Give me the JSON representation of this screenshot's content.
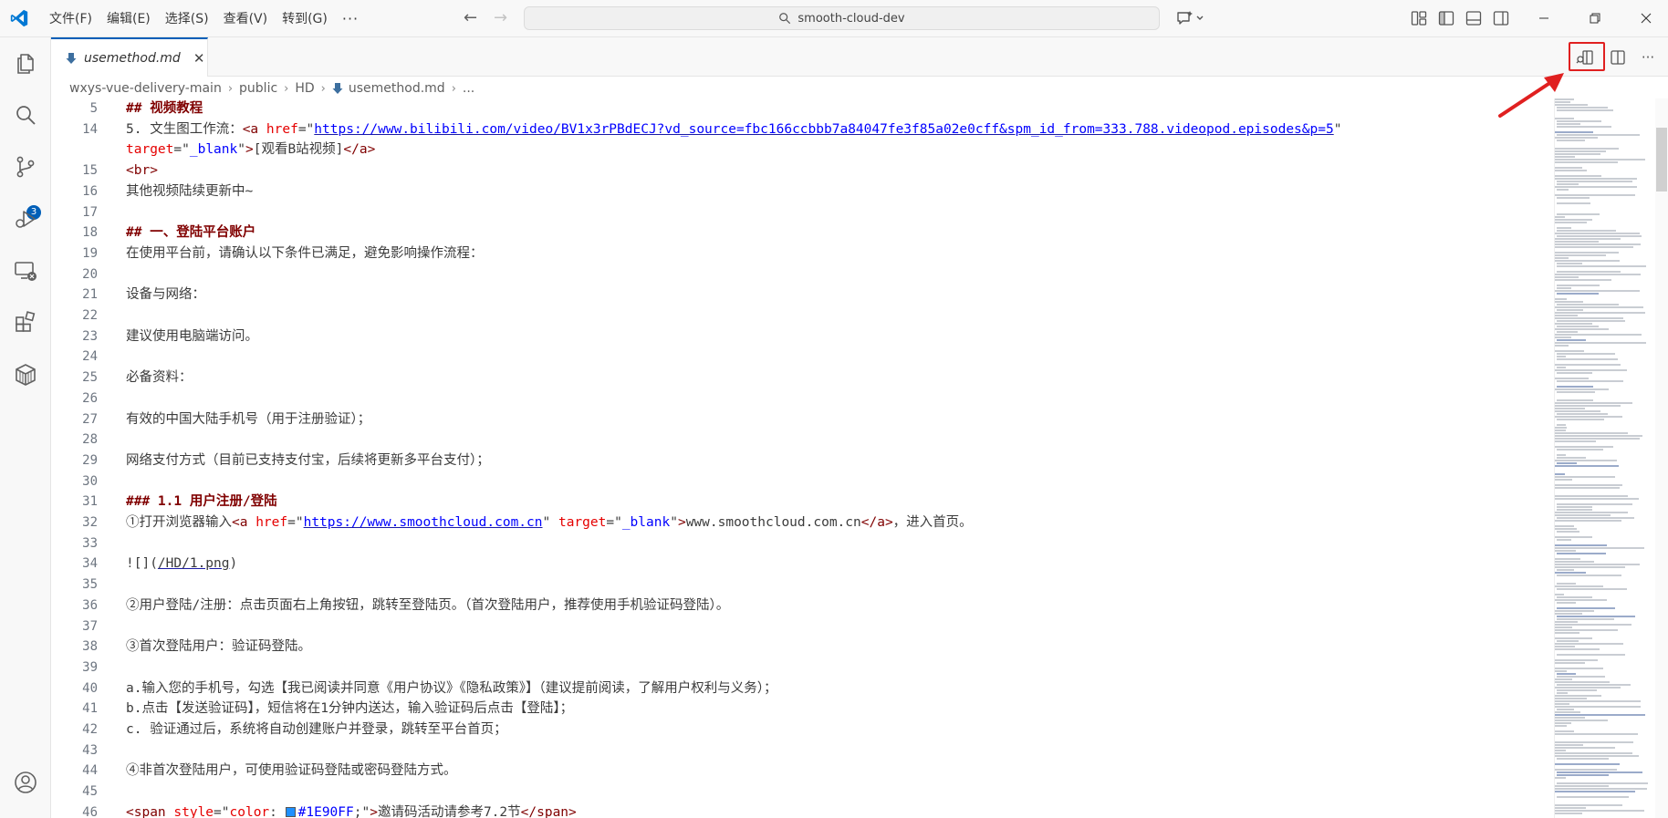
{
  "menu": {
    "items": [
      "文件(F)",
      "编辑(E)",
      "选择(S)",
      "查看(V)",
      "转到(G)"
    ],
    "more": "···"
  },
  "search": {
    "text": "smooth-cloud-dev"
  },
  "activity": {
    "scm_badge": "3"
  },
  "tab": {
    "label": "usemethod.md",
    "close": "✕"
  },
  "editor_actions": {
    "more": "···"
  },
  "breadcrumb": [
    "wxys-vue-delivery-main",
    "public",
    "HD",
    "usemethod.md",
    "..."
  ],
  "lines": [
    {
      "n": "5",
      "parts": [
        [
          "hd",
          "## 视频教程"
        ]
      ]
    },
    {
      "n": "14",
      "parts": [
        [
          "",
          "5. 文生图工作流："
        ],
        [
          "tg",
          "<a "
        ],
        [
          "at",
          "href"
        ],
        [
          "",
          "=\""
        ],
        [
          "sv ul",
          "https://www.bilibili.com/video/BV1x3rPBdECJ?vd_source=fbc166ccbbb7a84047fe3f85a02e0cff&spm_id_from=333.788.videopod.episodes&p=5"
        ],
        [
          "",
          "\""
        ]
      ]
    },
    {
      "n": "",
      "parts": [
        [
          "at",
          "target"
        ],
        [
          "",
          "=\""
        ],
        [
          "sv",
          "_blank"
        ],
        [
          "",
          "\""
        ],
        [
          "tg",
          ">"
        ],
        [
          "",
          "[观看B站视频]"
        ],
        [
          "tg",
          "</a>"
        ]
      ]
    },
    {
      "n": "15",
      "parts": [
        [
          "tg",
          "<br>"
        ]
      ]
    },
    {
      "n": "16",
      "parts": [
        [
          "",
          "其他视频陆续更新中~"
        ]
      ]
    },
    {
      "n": "17",
      "parts": []
    },
    {
      "n": "18",
      "parts": [
        [
          "hd",
          "## 一、登陆平台账户"
        ]
      ]
    },
    {
      "n": "19",
      "parts": [
        [
          "",
          "在使用平台前，请确认以下条件已满足，避免影响操作流程："
        ]
      ]
    },
    {
      "n": "20",
      "parts": []
    },
    {
      "n": "21",
      "parts": [
        [
          "",
          "设备与网络："
        ]
      ]
    },
    {
      "n": "22",
      "parts": []
    },
    {
      "n": "23",
      "parts": [
        [
          "",
          "建议使用电脑端访问。"
        ]
      ]
    },
    {
      "n": "24",
      "parts": []
    },
    {
      "n": "25",
      "parts": [
        [
          "",
          "必备资料："
        ]
      ]
    },
    {
      "n": "26",
      "parts": []
    },
    {
      "n": "27",
      "parts": [
        [
          "",
          "有效的中国大陆手机号（用于注册验证）；"
        ]
      ]
    },
    {
      "n": "28",
      "parts": []
    },
    {
      "n": "29",
      "parts": [
        [
          "",
          "网络支付方式（目前已支持支付宝，后续将更新多平台支付）；"
        ]
      ]
    },
    {
      "n": "30",
      "parts": []
    },
    {
      "n": "31",
      "parts": [
        [
          "hd",
          "### 1.1 用户注册/登陆"
        ]
      ]
    },
    {
      "n": "32",
      "parts": [
        [
          "",
          "①打开浏览器输入"
        ],
        [
          "tg",
          "<a "
        ],
        [
          "at",
          "href"
        ],
        [
          "",
          "=\""
        ],
        [
          "sv ul",
          "https://www.smoothcloud.com.cn"
        ],
        [
          "",
          "\" "
        ],
        [
          "at",
          "target"
        ],
        [
          "",
          "=\""
        ],
        [
          "sv",
          "_blank"
        ],
        [
          "",
          "\""
        ],
        [
          "tg",
          ">"
        ],
        [
          "",
          "www.smoothcloud.com.cn"
        ],
        [
          "tg",
          "</a>"
        ],
        [
          "",
          "，进入首页。"
        ]
      ]
    },
    {
      "n": "33",
      "parts": []
    },
    {
      "n": "34",
      "parts": [
        [
          "",
          "![]("
        ],
        [
          "ul",
          "/HD/1.png"
        ],
        [
          "",
          ")"
        ]
      ]
    },
    {
      "n": "35",
      "parts": []
    },
    {
      "n": "36",
      "parts": [
        [
          "",
          "②用户登陆/注册：点击页面右上角按钮，跳转至登陆页。（首次登陆用户，推荐使用手机验证码登陆）。"
        ]
      ]
    },
    {
      "n": "37",
      "parts": []
    },
    {
      "n": "38",
      "parts": [
        [
          "",
          "③首次登陆用户：验证码登陆。"
        ]
      ]
    },
    {
      "n": "39",
      "parts": []
    },
    {
      "n": "40",
      "parts": [
        [
          "",
          "a.输入您的手机号，勾选【我已阅读并同意《用户协议》《隐私政策》】（建议提前阅读，了解用户权利与义务）；"
        ]
      ]
    },
    {
      "n": "41",
      "parts": [
        [
          "",
          "b.点击【发送验证码】，短信将在1分钟内送达，输入验证码后点击【登陆】；"
        ]
      ]
    },
    {
      "n": "42",
      "parts": [
        [
          "",
          "c. 验证通过后，系统将自动创建账户并登录，跳转至平台首页；"
        ]
      ]
    },
    {
      "n": "43",
      "parts": []
    },
    {
      "n": "44",
      "parts": [
        [
          "",
          "④非首次登陆用户，可使用验证码登陆或密码登陆方式。"
        ]
      ]
    },
    {
      "n": "45",
      "parts": []
    },
    {
      "n": "46",
      "parts": [
        [
          "tg",
          "<span "
        ],
        [
          "at",
          "style"
        ],
        [
          "",
          "=\""
        ],
        [
          "at",
          "color"
        ],
        [
          "",
          ": "
        ],
        [
          "swatch",
          "#1E90FF"
        ],
        [
          "sv",
          "#1E90FF"
        ],
        [
          "",
          ";\""
        ],
        [
          "tg",
          ">"
        ],
        [
          "",
          "邀请码活动请参考7.2节"
        ],
        [
          "tg",
          "</span>"
        ]
      ]
    }
  ],
  "colors": {
    "accent": "#005fb8",
    "highlight": "#e02020",
    "swatch": "#1E90FF"
  }
}
